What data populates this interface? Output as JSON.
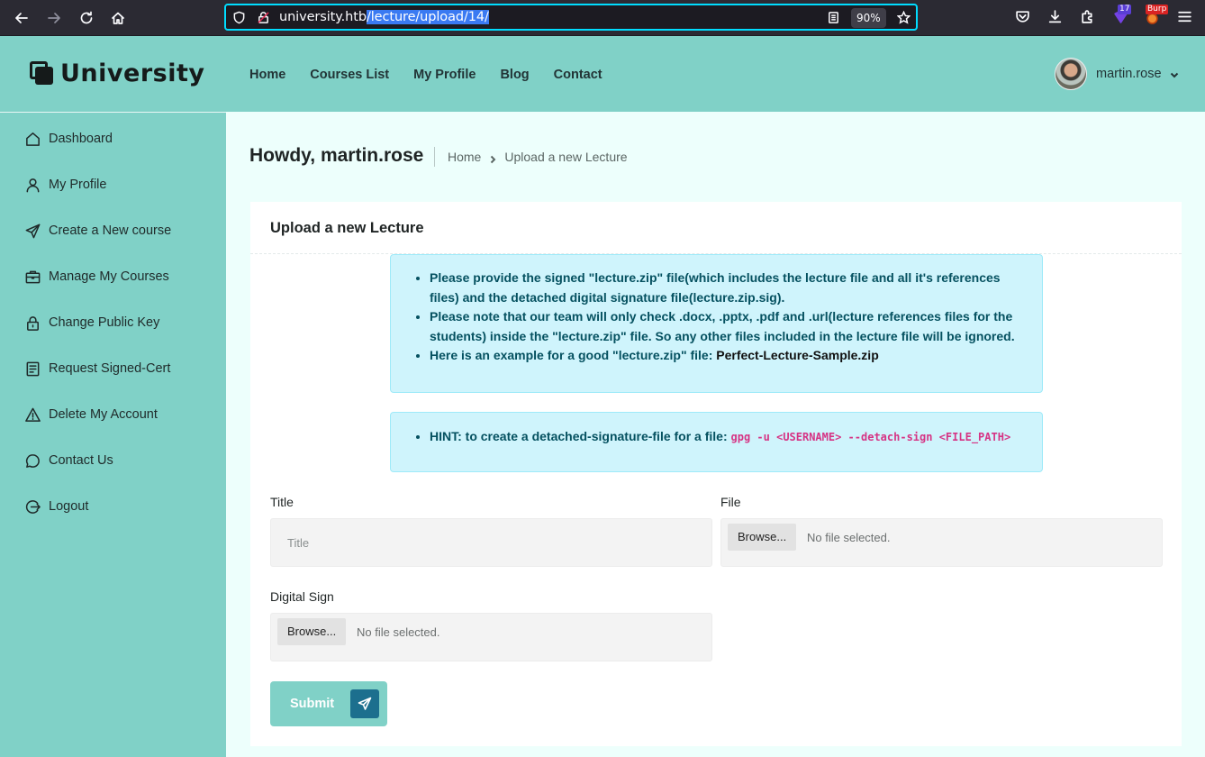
{
  "browser": {
    "url_host": "university.htb",
    "url_path": "/lecture/upload/14/",
    "zoom": "90%",
    "ext_badge_count": "17",
    "ext_badge_burp": "Burp"
  },
  "header": {
    "logo": "University",
    "nav": [
      "Home",
      "Courses List",
      "My Profile",
      "Blog",
      "Contact"
    ],
    "username": "martin.rose"
  },
  "sidebar": {
    "items": [
      {
        "label": "Dashboard",
        "icon": "home-icon"
      },
      {
        "label": "My Profile",
        "icon": "user-icon"
      },
      {
        "label": "Create a New course",
        "icon": "send-icon"
      },
      {
        "label": "Manage My Courses",
        "icon": "briefcase-icon"
      },
      {
        "label": "Change Public Key",
        "icon": "lock-icon"
      },
      {
        "label": "Request Signed-Cert",
        "icon": "document-icon"
      },
      {
        "label": "Delete My Account",
        "icon": "warning-icon"
      },
      {
        "label": "Contact Us",
        "icon": "chat-icon"
      },
      {
        "label": "Logout",
        "icon": "logout-icon"
      }
    ]
  },
  "page": {
    "title": "Howdy, martin.rose",
    "breadcrumb": [
      "Home",
      "Upload a new Lecture"
    ]
  },
  "form": {
    "card_title": "Upload a new Lecture",
    "notes": [
      "Please provide the signed \"lecture.zip\" file(which includes the lecture file and all it's references files) and the detached digital signature file(lecture.zip.sig).",
      "Please note that our team will only check .docx, .pptx, .pdf and .url(lecture references files for the students) inside the \"lecture.zip\" file. So any other files included in the lecture file will be ignored."
    ],
    "example_prefix": "Here is an example for a good \"lecture.zip\" file: ",
    "example_link": "Perfect-Lecture-Sample.zip",
    "hint_prefix": "HINT: to create a detached-signature-file for a file: ",
    "hint_code": "gpg -u <USERNAME> --detach-sign <FILE_PATH>",
    "title_label": "Title",
    "title_placeholder": "Title",
    "file_label": "File",
    "sign_label": "Digital Sign",
    "browse_label": "Browse...",
    "no_file": "No file selected.",
    "submit": "Submit"
  }
}
